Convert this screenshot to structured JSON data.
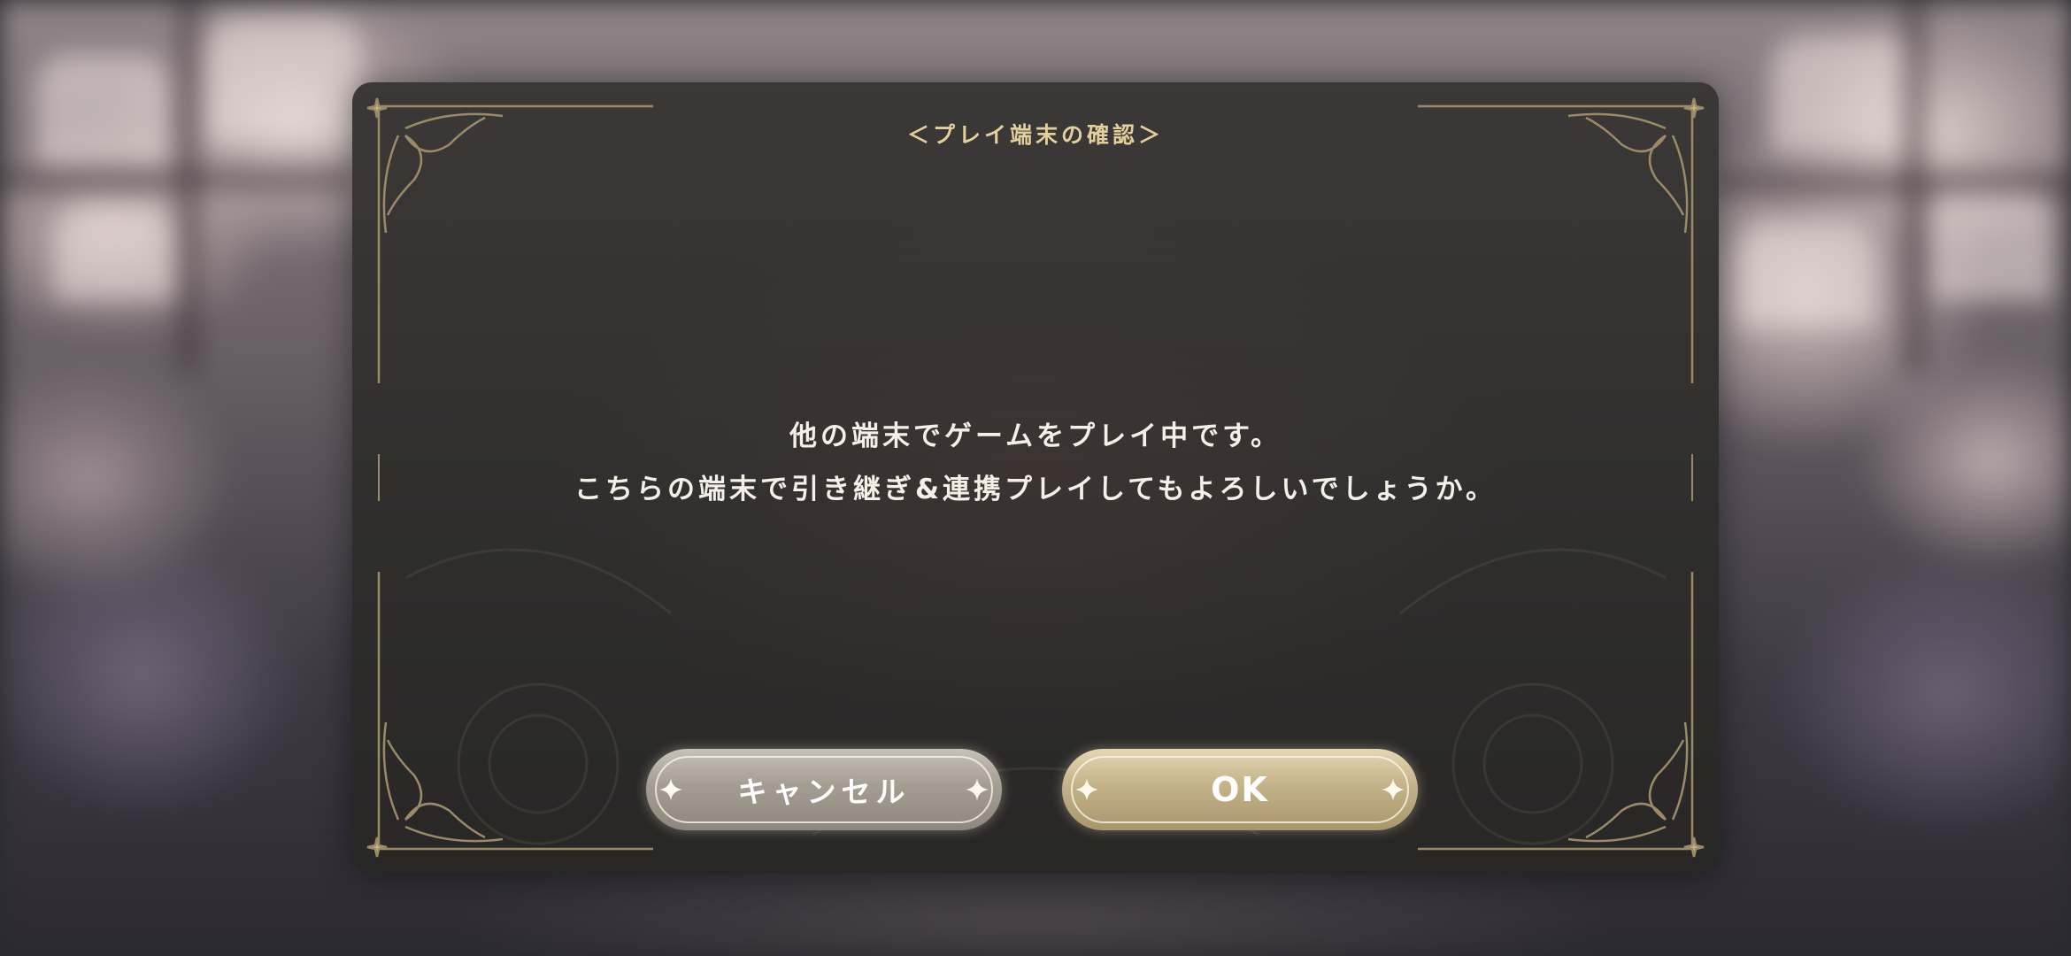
{
  "dialog": {
    "title": "＜プレイ端末の確認＞",
    "message_lines": [
      "他の端末でゲームをプレイ中です。",
      "こちらの端末で引き継ぎ&連携プレイしてもよろしいでしょうか。"
    ]
  },
  "buttons": {
    "cancel_label": "キャンセル",
    "ok_label": "OK"
  },
  "colors": {
    "title_gold": "#e3cf9c",
    "message_text": "#f4f0e8",
    "dialog_bg": "#302f2e",
    "ornament_gold": "#9a8a66",
    "cancel_button": "#a59d91",
    "ok_button": "#c4b288"
  },
  "icons": {
    "button_spark": "four-point-star-icon",
    "corner_ornament": "filigree-corner-icon"
  }
}
